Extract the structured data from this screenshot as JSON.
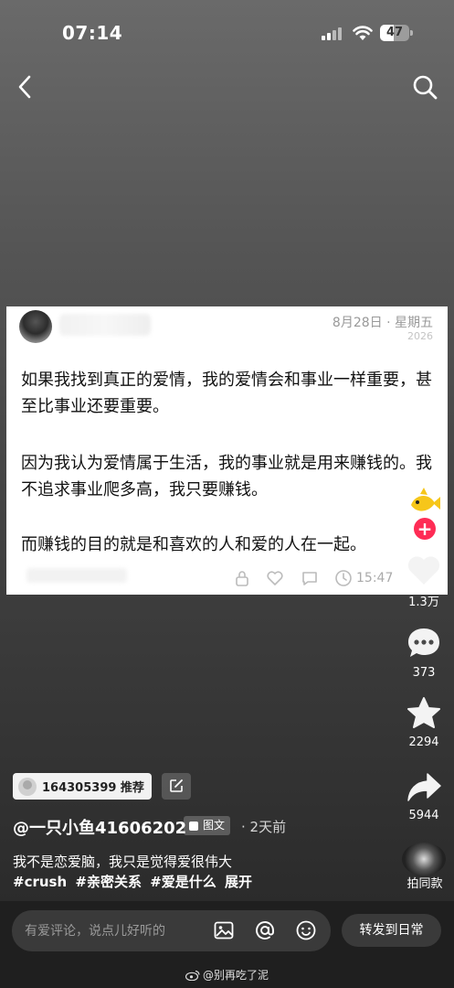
{
  "status_bar": {
    "time": "07:14",
    "battery": "47"
  },
  "post_card": {
    "date": "8月28日 · 星期五",
    "year": "2026",
    "paragraphs": [
      "如果我找到真正的爱情，我的爱情会和事业一样重要，甚至比事业还要重要。",
      "因为我认为爱情属于生活，我的事业就是用来赚钱的。我不追求事业爬多高，我只要赚钱。",
      "而赚钱的目的就是和喜欢的人和爱的人在一起。"
    ],
    "footer_time": "15:47"
  },
  "side_actions": {
    "like_count": "1.3万",
    "comment_count": "373",
    "favorite_count": "2294",
    "share_count": "5944",
    "music_label": "拍同款"
  },
  "recommend_chip": {
    "text": "164305399 推荐"
  },
  "author": {
    "name": "@一只小鱼41606202",
    "post_type": "图文",
    "time": "· 2天前"
  },
  "caption": "我不是恋爱脑，我只是觉得爱很伟大",
  "tags": [
    "#crush",
    "#亲密关系",
    "#爱是什么",
    "展开"
  ],
  "comment_bar": {
    "placeholder": "有爱评论，说点儿好听的",
    "forward_label": "转发到日常"
  },
  "watermark": "@别再吃了泥",
  "colors": {
    "accent_red": "#fe2c55",
    "card_bg": "#ffffff"
  }
}
